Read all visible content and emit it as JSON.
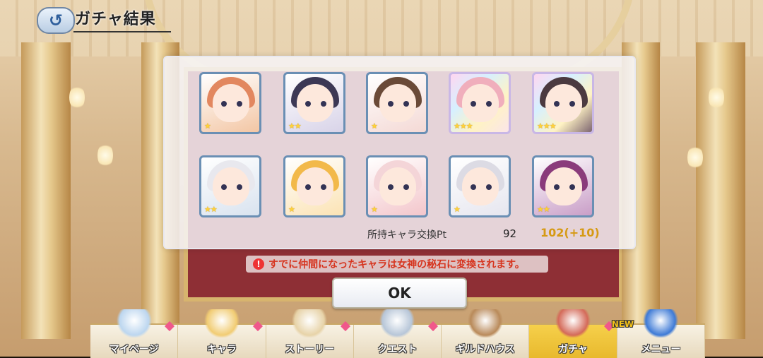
{
  "header": {
    "back_icon": "back-arrow-icon",
    "title": "ガチャ結果"
  },
  "results": {
    "cards": [
      {
        "stars": "★",
        "hair": "#e2875f",
        "bg": "#f3c6a4",
        "rarity": "normal"
      },
      {
        "stars": "★★",
        "hair": "#3c3855",
        "bg": "#d8d3e8",
        "rarity": "normal"
      },
      {
        "stars": "★",
        "hair": "#6a4a38",
        "bg": "#f4d9d5",
        "rarity": "normal"
      },
      {
        "stars": "★★★",
        "hair": "#f0aebc",
        "bg": "#fbe5e9",
        "rarity": "rainbow"
      },
      {
        "stars": "★★★",
        "hair": "#4b3a40",
        "bg": "#7d6570",
        "rarity": "rainbow"
      },
      {
        "stars": "★★",
        "hair": "#e8e8ee",
        "bg": "#d9e3ef",
        "rarity": "normal"
      },
      {
        "stars": "★",
        "hair": "#f2b94a",
        "bg": "#fbe3b4",
        "rarity": "normal"
      },
      {
        "stars": "★",
        "hair": "#f4d5d8",
        "bg": "#f3c6cb",
        "rarity": "normal"
      },
      {
        "stars": "★",
        "hair": "#dcdbe4",
        "bg": "#e6e6ef",
        "rarity": "normal"
      },
      {
        "stars": "★★",
        "hair": "#8a3b7b",
        "bg": "#c99ec7",
        "rarity": "normal"
      }
    ],
    "pt_label": "所持キャラ交換Pt",
    "pt_current": "92",
    "pt_new": "102(+10)"
  },
  "notice": {
    "icon": "warning-icon",
    "text": "すでに仲間になったキャラは女神の秘石に変換されます。"
  },
  "ok_label": "OK",
  "nav": {
    "items": [
      {
        "label": "マイページ",
        "icon": "mypage-castle-icon",
        "badge": true,
        "active": false,
        "new": false,
        "color": "#bcd6ef"
      },
      {
        "label": "キャラ",
        "icon": "character-icon",
        "badge": true,
        "active": false,
        "new": false,
        "color": "#f1cc73"
      },
      {
        "label": "ストーリー",
        "icon": "scroll-icon",
        "badge": true,
        "active": false,
        "new": false,
        "color": "#e7d3a8"
      },
      {
        "label": "クエスト",
        "icon": "sword-shield-icon",
        "badge": true,
        "active": false,
        "new": false,
        "color": "#b7c6d8"
      },
      {
        "label": "ギルドハウス",
        "icon": "guild-door-icon",
        "badge": false,
        "active": false,
        "new": false,
        "color": "#b98a5a"
      },
      {
        "label": "ガチャ",
        "icon": "gacha-machine-icon",
        "badge": true,
        "active": true,
        "new": false,
        "color": "#d46a59"
      },
      {
        "label": "メニュー",
        "icon": "menu-crystal-icon",
        "badge": false,
        "active": false,
        "new": true,
        "new_text": "NEW",
        "color": "#3d7ad6"
      }
    ]
  }
}
